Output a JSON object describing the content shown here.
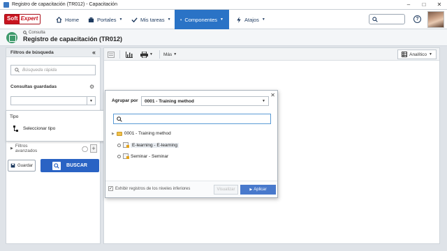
{
  "window": {
    "title": "Registro de capacitación (TR012) - Capacitación"
  },
  "nav": {
    "logo_a": "Soft",
    "logo_b": "Expert",
    "items": [
      {
        "label": "Home",
        "icon": "home-icon"
      },
      {
        "label": "Portales",
        "icon": "briefcase-icon"
      },
      {
        "label": "Mis tareas",
        "icon": "check-icon"
      },
      {
        "label": "Componentes",
        "icon": "trophy-icon",
        "active": true
      },
      {
        "label": "Atajos",
        "icon": "lightning-icon"
      }
    ],
    "help": "?"
  },
  "page": {
    "breadcrumb": "Consulta",
    "title": "Registro de capacitación (TR012)"
  },
  "filters": {
    "header": "Filtros de búsqueda",
    "quick_search_placeholder": "Búsqueda rápida",
    "saved_label": "Consultas guardadas",
    "advanced_label": "Filtros avanzados",
    "save_button": "Guardar",
    "search_button": "BUSCAR"
  },
  "tipo": {
    "label": "Tipo",
    "select_label": "Seleccionar tipo"
  },
  "toolbar": {
    "more_label": "Más",
    "view_label": "Analítico"
  },
  "dialog": {
    "group_label": "Agrupar por",
    "group_value": "0001 - Training method",
    "tree": [
      "0001 - Training method",
      "E-learning - E-learning",
      "Seminar - Seminar"
    ],
    "checkbox_label": "Exhibir registros de los niveles inferiores",
    "view_button": "Visualizar",
    "apply_button": "Aplicar"
  }
}
